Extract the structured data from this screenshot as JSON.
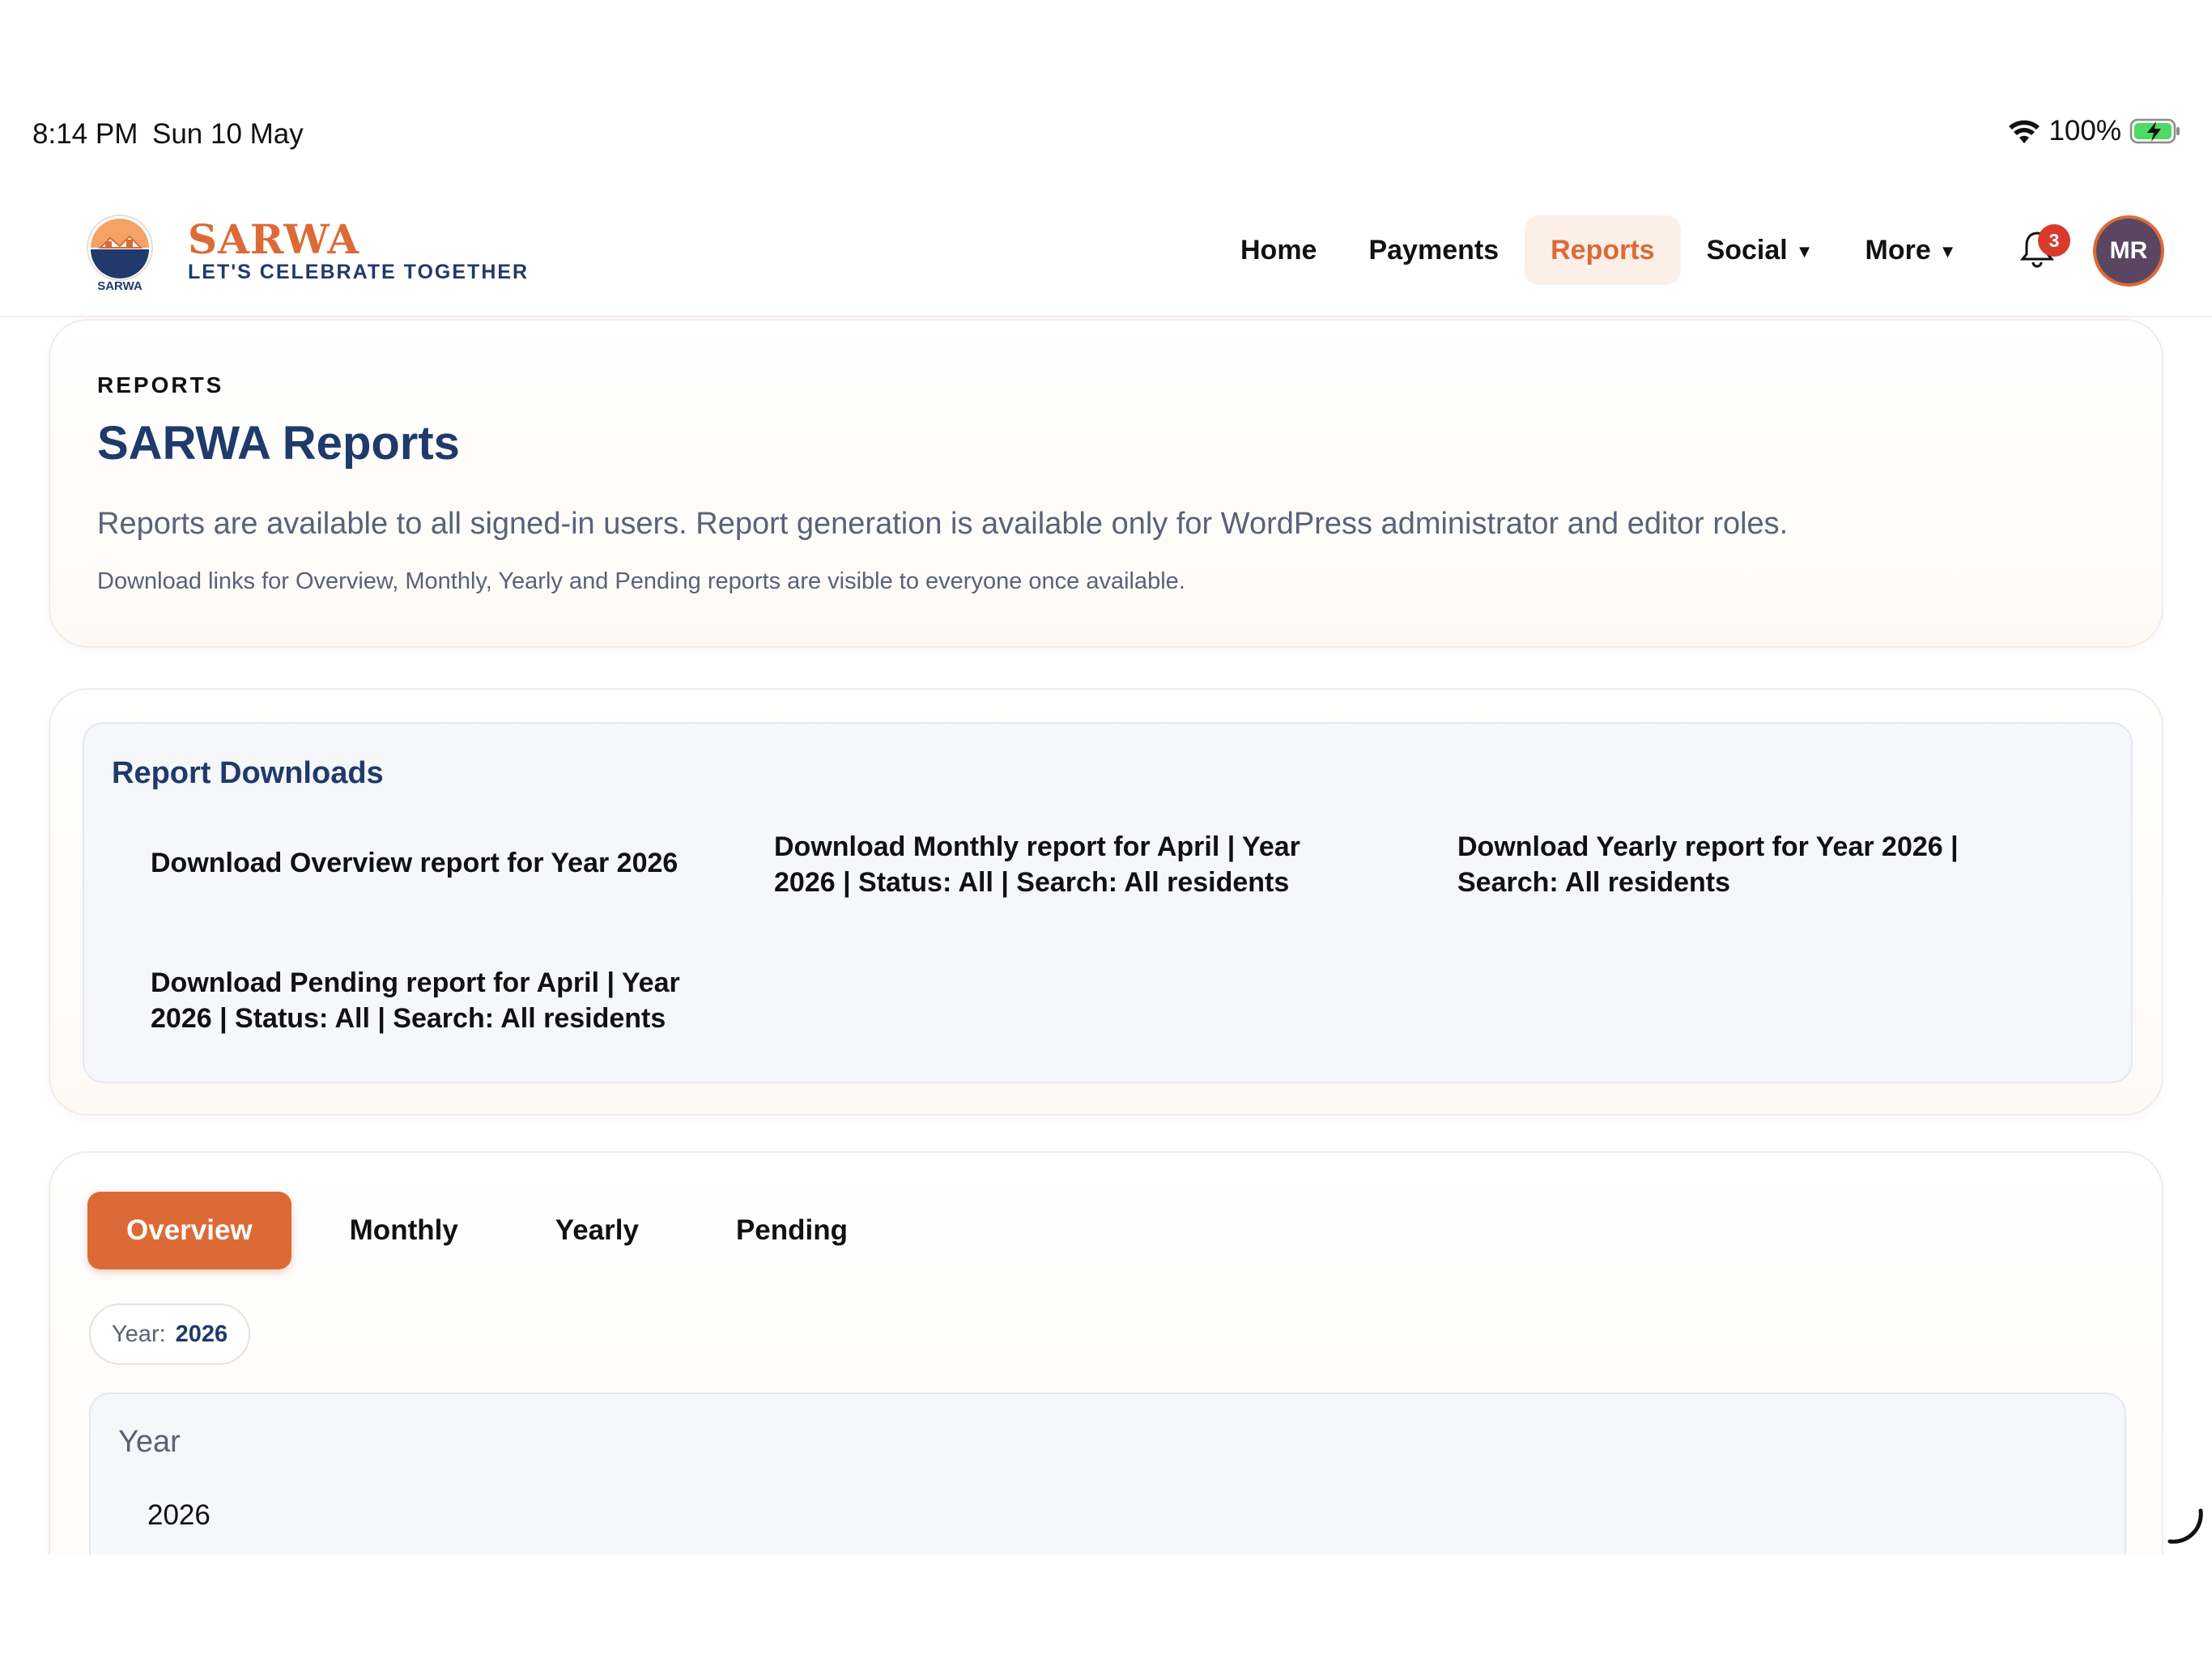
{
  "status_bar": {
    "time": "8:14 PM",
    "date": "Sun 10 May",
    "battery": "100%"
  },
  "header": {
    "brand_name": "SARWA",
    "tagline": "LET'S CELEBRATE TOGETHER",
    "logo_text": "SARWA",
    "nav": {
      "home": "Home",
      "payments": "Payments",
      "reports": "Reports",
      "social": "Social",
      "more": "More"
    },
    "notification_count": "3",
    "avatar_initials": "MR",
    "colors": {
      "accent": "#dc6a36",
      "navy": "#1f3a6b"
    }
  },
  "intro": {
    "eyebrow": "REPORTS",
    "title": "SARWA Reports",
    "lead": "Reports are available to all signed-in users. Report generation is available only for WordPress administrator and editor roles.",
    "note": "Download links for Overview, Monthly, Yearly and Pending reports are visible to everyone once available."
  },
  "downloads": {
    "title": "Report Downloads",
    "links": [
      "Download Overview report for Year 2026",
      "Download Monthly report for April | Year 2026 | Status: All | Search: All residents",
      "Download Yearly report for Year 2026 | Search: All residents",
      "Download Pending report for April | Year 2026 | Status: All | Search: All residents"
    ]
  },
  "report_tabs": {
    "overview": "Overview",
    "monthly": "Monthly",
    "yearly": "Yearly",
    "pending": "Pending",
    "active": "Overview"
  },
  "filter_chip": {
    "label": "Year:",
    "value": "2026"
  },
  "year_panel": {
    "heading": "Year",
    "value": "2026"
  }
}
